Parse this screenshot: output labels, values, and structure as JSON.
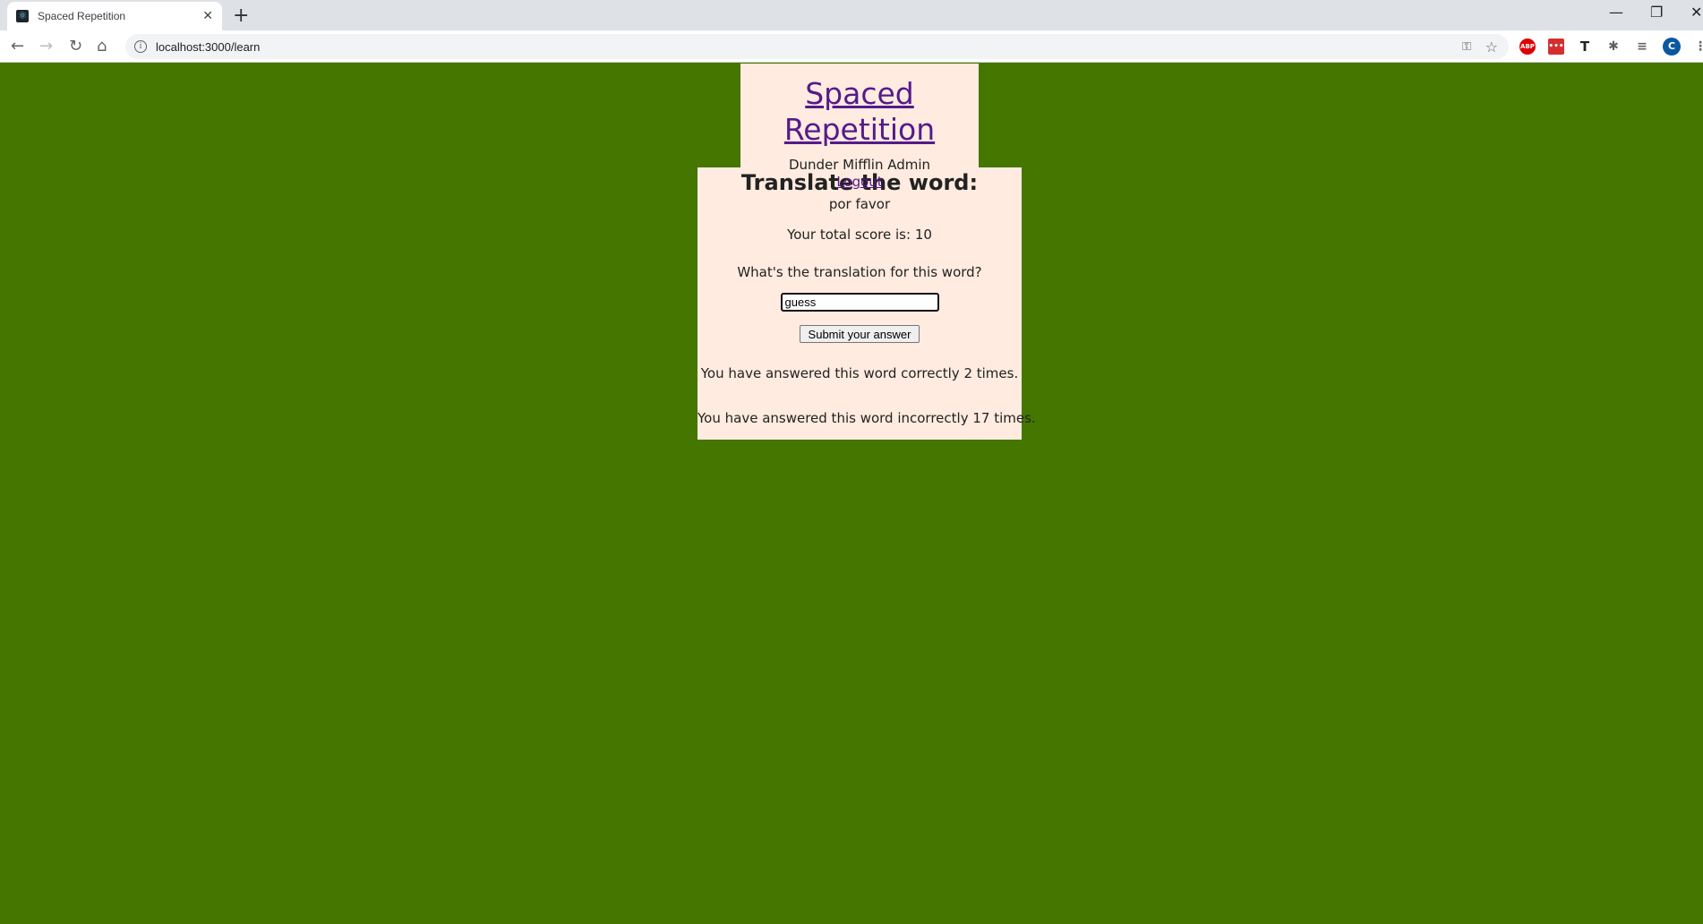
{
  "browser": {
    "tab_title": "Spaced Repetition",
    "url": "localhost:3000/learn",
    "profile_initial": "C"
  },
  "header": {
    "title": "Spaced Repetition",
    "user": "Dunder Mifflin Admin",
    "logout": "Logout"
  },
  "main": {
    "heading": "Translate the word:",
    "word": "por favor",
    "score": "Your total score is: 10",
    "question": "What's the translation for this word?",
    "input_value": "guess",
    "submit": "Submit your answer",
    "correct": "You have answered this word correctly 2 times.",
    "incorrect": "You have answered this word incorrectly 17 times."
  },
  "colors": {
    "background": "#457600",
    "panel": "#ffebdf",
    "link": "#551a8b"
  }
}
